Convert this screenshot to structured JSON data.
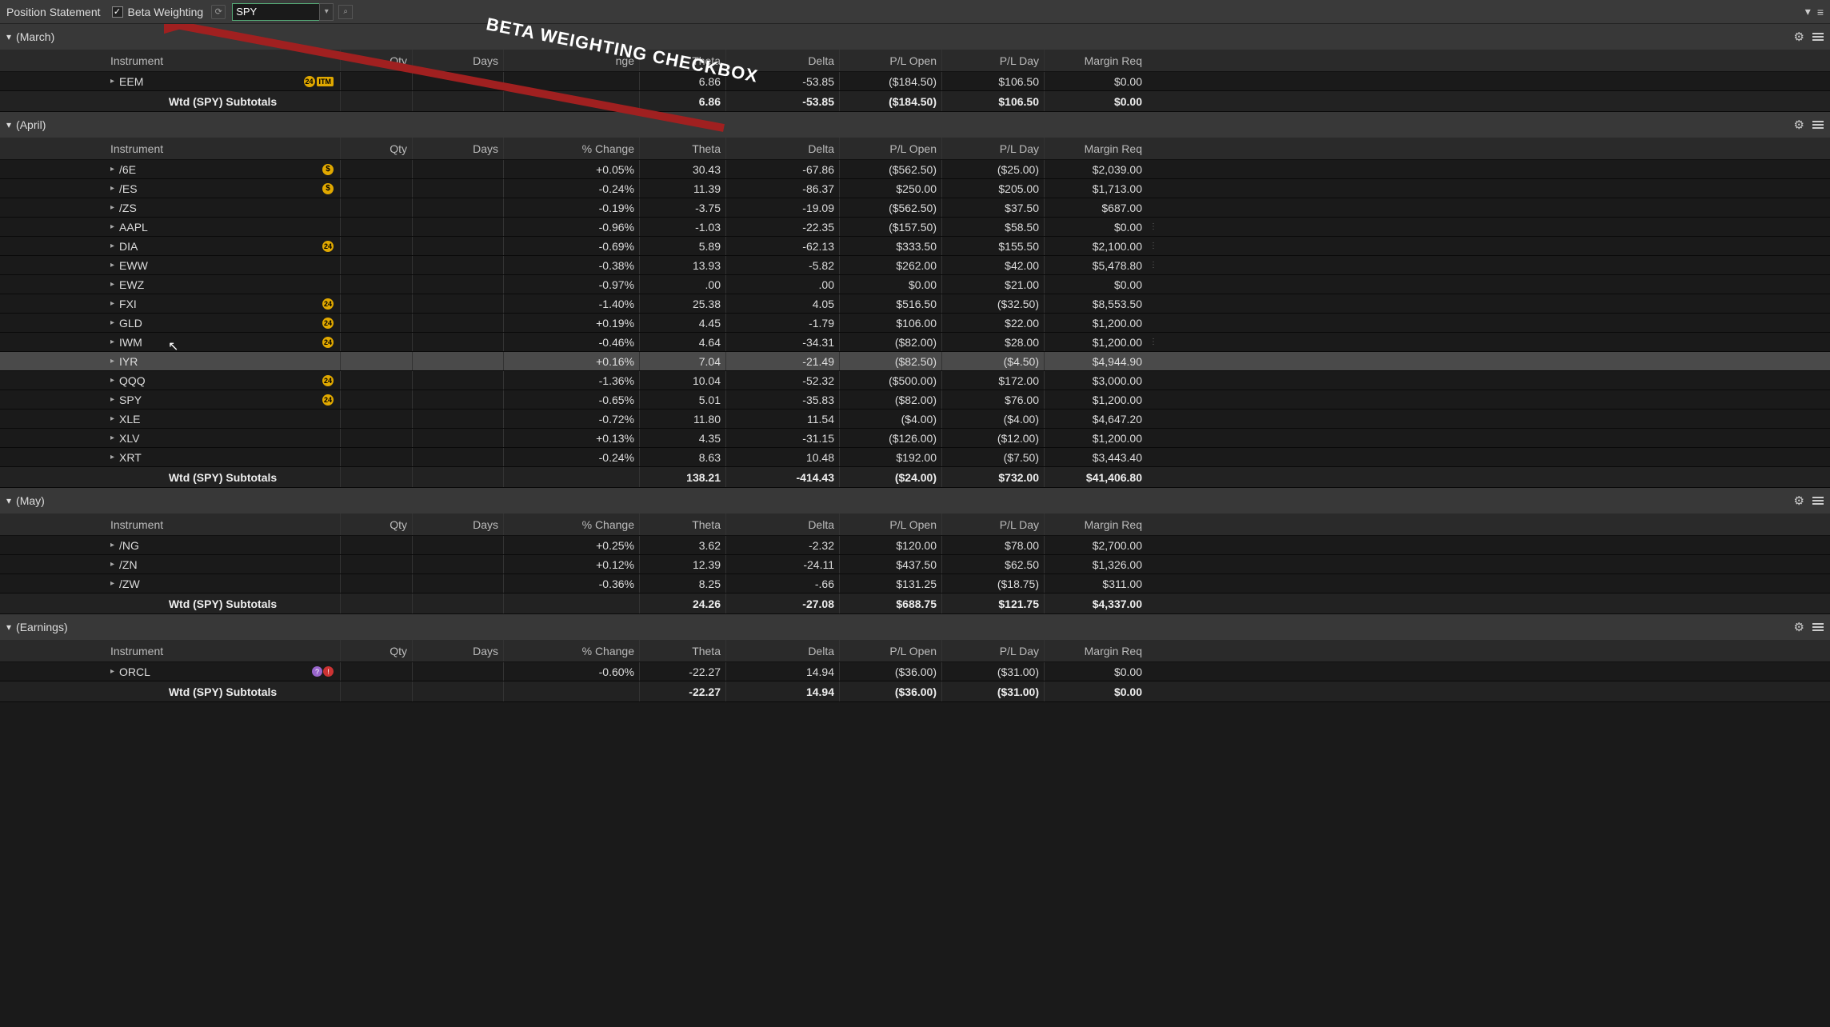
{
  "toolbar": {
    "title": "Position Statement",
    "beta_label": "Beta Weighting",
    "symbol_value": "SPY"
  },
  "annotation": {
    "text": "BETA WEIGHTING CHECKBOX"
  },
  "columns": {
    "instrument": "Instrument",
    "qty": "Qty",
    "days": "Days",
    "change": "% Change",
    "theta": "Theta",
    "delta": "Delta",
    "plopen": "P/L Open",
    "plday": "P/L Day",
    "margin": "Margin Req"
  },
  "columns_short": {
    "change": "nge"
  },
  "subtotal_label": "Wtd (SPY) Subtotals",
  "groups": [
    {
      "name": "(March)",
      "rows": [
        {
          "inst": "EEM",
          "badge": "itm",
          "chg": "",
          "theta": "6.86",
          "delta": "-53.85",
          "plopen": "($184.50)",
          "plday": "$106.50",
          "margin": "$0.00"
        }
      ],
      "subtotal": {
        "theta": "6.86",
        "delta": "-53.85",
        "plopen": "($184.50)",
        "plday": "$106.50",
        "margin": "$0.00"
      }
    },
    {
      "name": "(April)",
      "rows": [
        {
          "inst": "/6E",
          "badge": "dollar",
          "chg": "+0.05%",
          "theta": "30.43",
          "delta": "-67.86",
          "plopen": "($562.50)",
          "plday": "($25.00)",
          "margin": "$2,039.00"
        },
        {
          "inst": "/ES",
          "badge": "dollar",
          "chg": "-0.24%",
          "theta": "11.39",
          "delta": "-86.37",
          "plopen": "$250.00",
          "plday": "$205.00",
          "margin": "$1,713.00"
        },
        {
          "inst": "/ZS",
          "chg": "-0.19%",
          "theta": "-3.75",
          "delta": "-19.09",
          "plopen": "($562.50)",
          "plday": "$37.50",
          "margin": "$687.00"
        },
        {
          "inst": "AAPL",
          "chg": "-0.96%",
          "theta": "-1.03",
          "delta": "-22.35",
          "plopen": "($157.50)",
          "plday": "$58.50",
          "margin": "$0.00",
          "tail": "⋮"
        },
        {
          "inst": "DIA",
          "badge": "24",
          "chg": "-0.69%",
          "theta": "5.89",
          "delta": "-62.13",
          "plopen": "$333.50",
          "plday": "$155.50",
          "margin": "$2,100.00",
          "tail": "⋮"
        },
        {
          "inst": "EWW",
          "chg": "-0.38%",
          "theta": "13.93",
          "delta": "-5.82",
          "plopen": "$262.00",
          "plday": "$42.00",
          "margin": "$5,478.80",
          "tail": "⋮"
        },
        {
          "inst": "EWZ",
          "chg": "-0.97%",
          "theta": ".00",
          "delta": ".00",
          "plopen": "$0.00",
          "plday": "$21.00",
          "margin": "$0.00"
        },
        {
          "inst": "FXI",
          "badge": "24",
          "chg": "-1.40%",
          "theta": "25.38",
          "delta": "4.05",
          "plopen": "$516.50",
          "plday": "($32.50)",
          "margin": "$8,553.50"
        },
        {
          "inst": "GLD",
          "badge": "24",
          "chg": "+0.19%",
          "theta": "4.45",
          "delta": "-1.79",
          "plopen": "$106.00",
          "plday": "$22.00",
          "margin": "$1,200.00"
        },
        {
          "inst": "IWM",
          "badge": "24",
          "chg": "-0.46%",
          "theta": "4.64",
          "delta": "-34.31",
          "plopen": "($82.00)",
          "plday": "$28.00",
          "margin": "$1,200.00",
          "tail": "⋮"
        },
        {
          "inst": "IYR",
          "hover": true,
          "chg": "+0.16%",
          "theta": "7.04",
          "delta": "-21.49",
          "plopen": "($82.50)",
          "plday": "($4.50)",
          "margin": "$4,944.90"
        },
        {
          "inst": "QQQ",
          "badge": "24",
          "chg": "-1.36%",
          "theta": "10.04",
          "delta": "-52.32",
          "plopen": "($500.00)",
          "plday": "$172.00",
          "margin": "$3,000.00"
        },
        {
          "inst": "SPY",
          "badge": "24",
          "chg": "-0.65%",
          "theta": "5.01",
          "delta": "-35.83",
          "plopen": "($82.00)",
          "plday": "$76.00",
          "margin": "$1,200.00"
        },
        {
          "inst": "XLE",
          "chg": "-0.72%",
          "theta": "11.80",
          "delta": "11.54",
          "plopen": "($4.00)",
          "plday": "($4.00)",
          "margin": "$4,647.20"
        },
        {
          "inst": "XLV",
          "chg": "+0.13%",
          "theta": "4.35",
          "delta": "-31.15",
          "plopen": "($126.00)",
          "plday": "($12.00)",
          "margin": "$1,200.00"
        },
        {
          "inst": "XRT",
          "chg": "-0.24%",
          "theta": "8.63",
          "delta": "10.48",
          "plopen": "$192.00",
          "plday": "($7.50)",
          "margin": "$3,443.40"
        }
      ],
      "subtotal": {
        "theta": "138.21",
        "delta": "-414.43",
        "plopen": "($24.00)",
        "plday": "$732.00",
        "margin": "$41,406.80"
      }
    },
    {
      "name": "(May)",
      "rows": [
        {
          "inst": "/NG",
          "chg": "+0.25%",
          "theta": "3.62",
          "delta": "-2.32",
          "plopen": "$120.00",
          "plday": "$78.00",
          "margin": "$2,700.00"
        },
        {
          "inst": "/ZN",
          "chg": "+0.12%",
          "theta": "12.39",
          "delta": "-24.11",
          "plopen": "$437.50",
          "plday": "$62.50",
          "margin": "$1,326.00"
        },
        {
          "inst": "/ZW",
          "chg": "-0.36%",
          "theta": "8.25",
          "delta": "-.66",
          "plopen": "$131.25",
          "plday": "($18.75)",
          "margin": "$311.00"
        }
      ],
      "subtotal": {
        "theta": "24.26",
        "delta": "-27.08",
        "plopen": "$688.75",
        "plday": "$121.75",
        "margin": "$4,337.00"
      }
    },
    {
      "name": "(Earnings)",
      "rows": [
        {
          "inst": "ORCL",
          "badge": "qr",
          "chg": "-0.60%",
          "theta": "-22.27",
          "delta": "14.94",
          "plopen": "($36.00)",
          "plday": "($31.00)",
          "margin": "$0.00"
        }
      ],
      "subtotal": {
        "theta": "-22.27",
        "delta": "14.94",
        "plopen": "($36.00)",
        "plday": "($31.00)",
        "margin": "$0.00"
      }
    }
  ]
}
